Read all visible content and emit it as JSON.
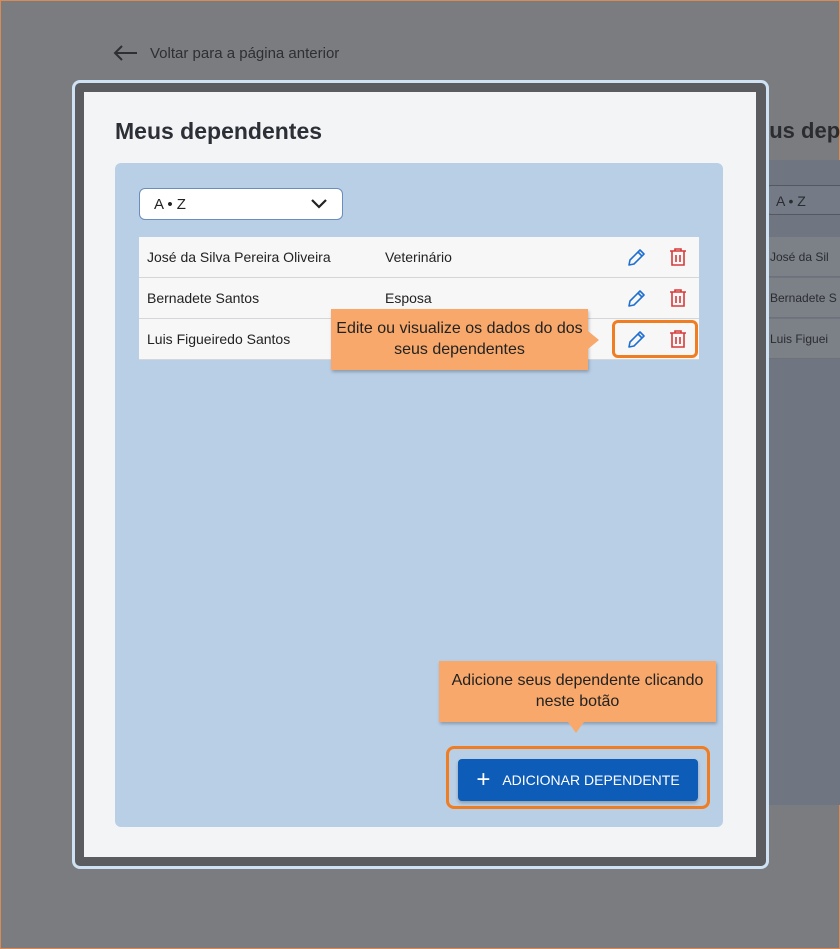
{
  "back_link": {
    "label": "Voltar para a página anterior",
    "icon": "arrow-left-icon"
  },
  "background_page": {
    "title_fragment": "eus dep",
    "select_fragment": "A • Z",
    "rows": [
      "José da Sil",
      "Bernadete S",
      "Luis Figuei"
    ]
  },
  "modal": {
    "title": "Meus dependentes",
    "sort": {
      "value": "A • Z",
      "icon": "chevron-down-icon"
    },
    "dependents": [
      {
        "name": "José da Silva Pereira Oliveira",
        "relation": "Veterinário"
      },
      {
        "name": "Bernadete Santos",
        "relation": "Esposa"
      },
      {
        "name": "Luis Figueiredo Santos",
        "relation": ""
      }
    ],
    "tooltip_actions": "Edite ou visualize os dados do dos seus dependentes",
    "tooltip_add": "Adicione seus dependente clicando neste botão",
    "add_button": {
      "label": "ADICIONAR DEPENDENTE",
      "icon": "plus-icon"
    }
  },
  "colors": {
    "accent_blue": "#0d5cb7",
    "edit_icon": "#1f6fd1",
    "delete_icon": "#d63b3b",
    "highlight": "#f07d22",
    "tooltip_bg": "#f8a86a"
  }
}
